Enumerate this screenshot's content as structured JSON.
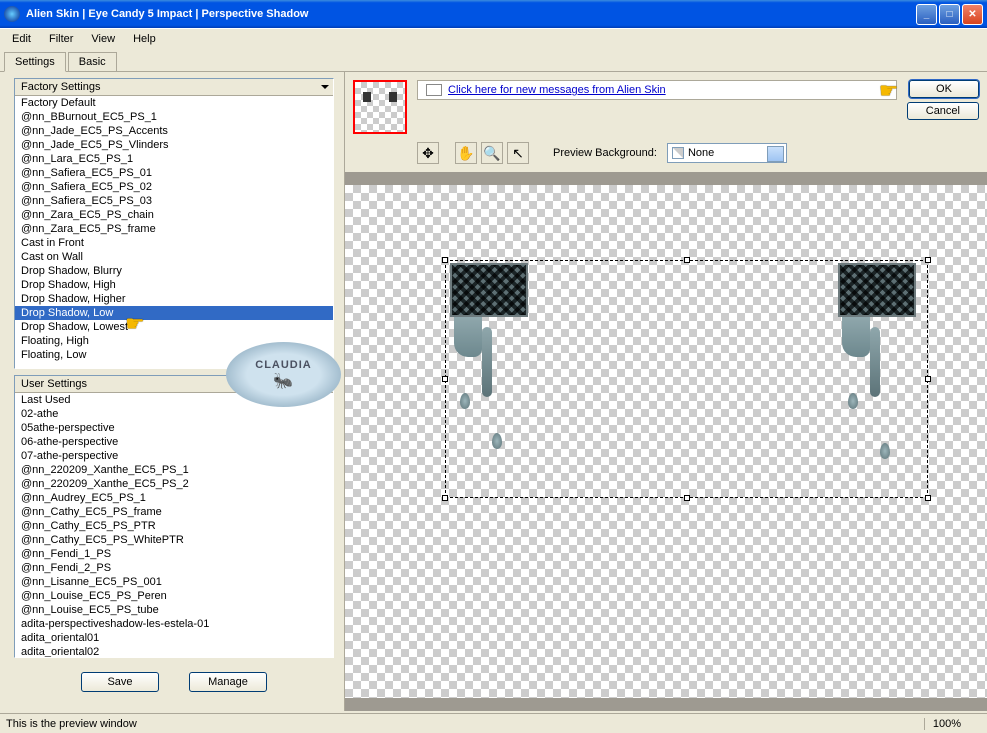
{
  "window": {
    "title": "Alien Skin  |  Eye Candy 5 Impact  |  Perspective Shadow"
  },
  "menu": [
    "Edit",
    "Filter",
    "View",
    "Help"
  ],
  "tabs": {
    "settings": "Settings",
    "basic": "Basic"
  },
  "factory": {
    "header": "Factory Settings",
    "items": [
      "Factory Default",
      "@nn_BBurnout_EC5_PS_1",
      "@nn_Jade_EC5_PS_Accents",
      "@nn_Jade_EC5_PS_Vlinders",
      "@nn_Lara_EC5_PS_1",
      "@nn_Safiera_EC5_PS_01",
      "@nn_Safiera_EC5_PS_02",
      "@nn_Safiera_EC5_PS_03",
      "@nn_Zara_EC5_PS_chain",
      "@nn_Zara_EC5_PS_frame",
      "Cast in Front",
      "Cast on Wall",
      "Drop Shadow, Blurry",
      "Drop Shadow, High",
      "Drop Shadow, Higher",
      "Drop Shadow, Low",
      "Drop Shadow, Lowest",
      "Floating, High",
      "Floating, Low"
    ],
    "selected_index": 15
  },
  "user": {
    "header": "User Settings",
    "items": [
      "Last Used",
      "02-athe",
      "05athe-perspective",
      "06-athe-perspective",
      "07-athe-perspective",
      "@nn_220209_Xanthe_EC5_PS_1",
      "@nn_220209_Xanthe_EC5_PS_2",
      "@nn_Audrey_EC5_PS_1",
      "@nn_Cathy_EC5_PS_frame",
      "@nn_Cathy_EC5_PS_PTR",
      "@nn_Cathy_EC5_PS_WhitePTR",
      "@nn_Fendi_1_PS",
      "@nn_Fendi_2_PS",
      "@nn_Lisanne_EC5_PS_001",
      "@nn_Louise_EC5_PS_Peren",
      "@nn_Louise_EC5_PS_tube",
      "adita-perspectiveshadow-les-estela-01",
      "adita_oriental01",
      "adita_oriental02"
    ]
  },
  "buttons": {
    "save": "Save",
    "manage": "Manage",
    "ok": "OK",
    "cancel": "Cancel"
  },
  "message": {
    "link": "Click here for new messages from Alien Skin"
  },
  "preview": {
    "bg_label": "Preview Background:",
    "bg_value": "None"
  },
  "status": {
    "text": "This is the preview window",
    "zoom": "100%"
  },
  "watermark": "CLAUDIA"
}
